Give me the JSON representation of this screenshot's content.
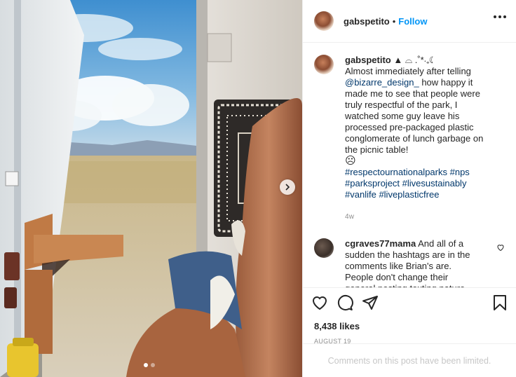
{
  "post": {
    "username": "gabspetito",
    "separator": "•",
    "follow_label": "Follow",
    "caption": {
      "username": "gabspetito",
      "username_suffix": " ▲ ⌓ .˚*‧₊☾",
      "text_part1": "Almost immediately after telling ",
      "mention": "@bizarre_design_",
      "text_part2": " how happy it made me to see that people were truly respectful of the park, I watched some guy leave his processed pre-packaged plastic conglomerate of lunch garbage on the picnic table!",
      "emoji": "☹",
      "hashtags": [
        "#respectournationalparks",
        "#nps",
        "#parksproject",
        "#livesustainably",
        "#vanlife",
        "#liveplasticfree"
      ],
      "time": "4w"
    },
    "comment": {
      "username": "cgraves77mama",
      "text": " And all of a sudden the hashtags are in the comments like Brian's are. People don't change their general posting texting nature overnight."
    },
    "likes": "8,438 likes",
    "date": "AUGUST 19",
    "comments_limited": "Comments on this post have been limited.",
    "carousel": {
      "current": 1,
      "total": 2
    },
    "icons": [
      "heart-icon",
      "comment-icon",
      "share-icon",
      "save-icon",
      "more-icon",
      "chevron-right-icon"
    ],
    "colors": {
      "link": "#00376b",
      "follow": "#0095f6",
      "muted": "#8e8e8e",
      "border": "#efefef"
    }
  }
}
